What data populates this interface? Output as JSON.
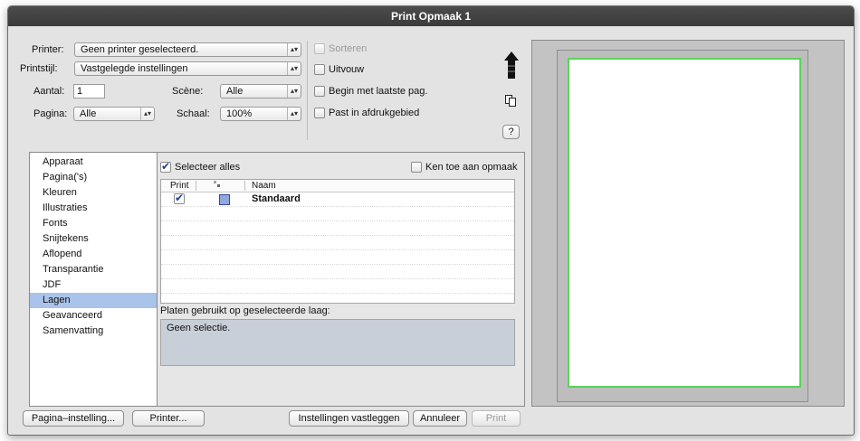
{
  "window": {
    "title": "Print Opmaak 1"
  },
  "top": {
    "printer_label": "Printer:",
    "printer_value": "Geen printer geselecteerd.",
    "style_label": "Printstijl:",
    "style_value": "Vastgelegde instellingen",
    "count_label": "Aantal:",
    "count_value": "1",
    "scene_label": "Scène:",
    "scene_value": "Alle",
    "page_label": "Pagina:",
    "page_value": "Alle",
    "scale_label": "Schaal:",
    "scale_value": "100%",
    "sort_label": "Sorteren",
    "expand_label": "Uitvouw",
    "begin_last_label": "Begin met laatste pag.",
    "fit_label": "Past in afdrukgebied",
    "help_label": "?"
  },
  "sidebar": {
    "items": [
      "Apparaat",
      "Pagina('s)",
      "Kleuren",
      "Illustraties",
      "Fonts",
      "Snijtekens",
      "Aflopend",
      "Transparantie",
      "JDF",
      "Lagen",
      "Geavanceerd",
      "Samenvatting"
    ],
    "selected": "Lagen"
  },
  "layers": {
    "select_all_label": "Selecteer alles",
    "apply_label": "Ken toe aan opmaak",
    "columns": [
      "Print",
      "",
      "Naam"
    ],
    "rows": [
      {
        "print": true,
        "color": "#8fa8e0",
        "name": "Standaard"
      }
    ],
    "plates_label": "Platen gebruikt op geselecteerde laag:",
    "plates_value": "Geen selectie."
  },
  "buttons": {
    "page_setup": "Pagina–instelling...",
    "printer": "Printer...",
    "save_settings": "Instellingen vastleggen",
    "cancel": "Annuleer",
    "print": "Print"
  },
  "colors": {
    "selection": "#a9c3ea",
    "preview_border": "#5bd25b"
  }
}
